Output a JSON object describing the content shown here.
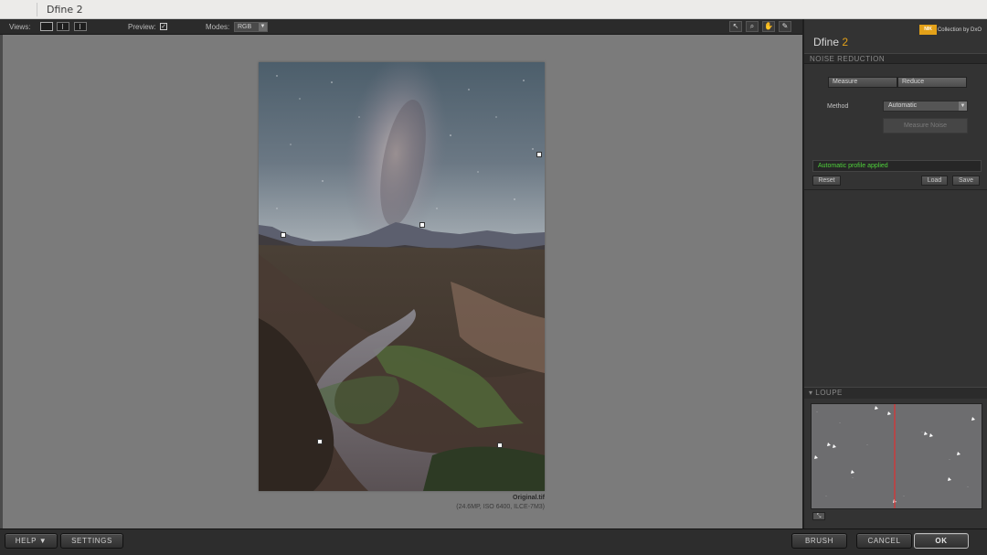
{
  "window": {
    "title": "Dfine 2"
  },
  "toolbar": {
    "views_label": "Views:",
    "preview_label": "Preview:",
    "preview_checked": "✓",
    "modes_label": "Modes:",
    "mode_value": "RGB",
    "tools": [
      "pointer-icon",
      "zoom-icon",
      "hand-icon",
      "color-picker-icon"
    ]
  },
  "image": {
    "filename": "Original.tif",
    "meta": "(24.6MP, ISO 6400, ILCE-7M3)"
  },
  "panel": {
    "brand": "Collection by DxO",
    "brand_logo": "NIK",
    "app_name": "Dfine",
    "app_version": "2",
    "section_title": "NOISE REDUCTION",
    "tabs": [
      "Measure",
      "Reduce"
    ],
    "method_label": "Method",
    "method_value": "Automatic",
    "measure_noise_label": "Measure Noise",
    "status_text": "Automatic profile applied",
    "reset_label": "Reset",
    "load_label": "Load",
    "save_label": "Save",
    "loupe_title": "LOUPE"
  },
  "bottom": {
    "help_label": "HELP ▼",
    "settings_label": "SETTINGS",
    "brush_label": "BRUSH",
    "cancel_label": "CANCEL",
    "ok_label": "OK"
  },
  "colors": {
    "accent": "#e3a119",
    "status_green": "#4fd13b",
    "canvas_bg": "#7b7b7b",
    "panel_bg": "#333333"
  }
}
